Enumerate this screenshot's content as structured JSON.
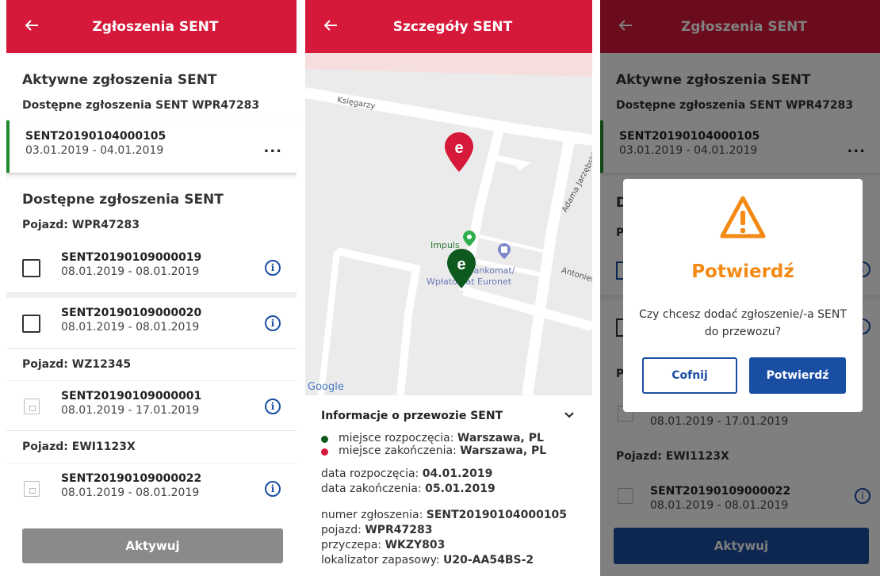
{
  "screen1": {
    "title": "Zgłoszenia SENT",
    "active_header": "Aktywne zgłoszenia SENT",
    "active_sub": "Dostępne zgłoszenia SENT WPR47283",
    "active_item": {
      "code": "SENT20190104000105",
      "dates": "03.01.2019 - 04.01.2019",
      "more": "..."
    },
    "available_header": "Dostępne zgłoszenia SENT",
    "groups": [
      {
        "vehicle": "Pojazd: WPR47283",
        "items": [
          {
            "code": "SENT20190109000019",
            "dates": "08.01.2019 - 08.01.2019"
          },
          {
            "code": "SENT20190109000020",
            "dates": "08.01.2019 - 08.01.2019"
          }
        ]
      },
      {
        "vehicle": "Pojazd: WZ12345",
        "items": [
          {
            "code": "SENT20190109000001",
            "dates": "08.01.2019 - 17.01.2019"
          }
        ]
      },
      {
        "vehicle": "Pojazd: EWI1123X",
        "items": [
          {
            "code": "SENT20190109000022",
            "dates": "08.01.2019 - 08.01.2019"
          }
        ]
      }
    ],
    "activate_label": "Aktywuj"
  },
  "screen2": {
    "title": "Szczegóły SENT",
    "map_labels": {
      "street1": "Księgarzy",
      "street2": "Adama Jarzębskiego",
      "street3": "Antoniewska",
      "poi1": "Impuls",
      "poi2": "Bankomat/",
      "poi3": "Wpłatomat Euronet",
      "google": "Google"
    },
    "info_title": "Informacje o przewozie SENT",
    "start_label": "miejsce rozpoczęcia: ",
    "start_value": "Warszawa, PL",
    "end_label": "miejsce zakończenia: ",
    "end_value": "Warszawa, PL",
    "date_start_label": "data rozpoczęcia: ",
    "date_start_value": "04.01.2019",
    "date_end_label": "data zakończenia: ",
    "date_end_value": "05.01.2019",
    "number_label": "numer zgłoszenia: ",
    "number_value": "SENT20190104000105",
    "vehicle_label": "pojazd: ",
    "vehicle_value": "WPR47283",
    "trailer_label": "przyczepa: ",
    "trailer_value": "WKZY803",
    "locator_label": "lokalizator zapasowy: ",
    "locator_value": "U20-AA54BS-2"
  },
  "screen3": {
    "title": "Zgłoszenia SENT",
    "active_header": "Aktywne zgłoszenia SENT",
    "active_sub": "Dostępne zgłoszenia SENT WPR47283",
    "active_item": {
      "code": "SENT20190104000105",
      "dates": "03.01.2019 - 04.01.2019"
    },
    "bg_dates": "08.01.2019 - 17.01.2019",
    "bg_vehicle": "Pojazd: EWI1123X",
    "bg_item": {
      "code": "SENT20190109000022",
      "dates": "08.01.2019 - 08.01.2019"
    },
    "dialog_title": "Potwierdź",
    "dialog_message": "Czy chcesz dodać zgłoszenie/-a SENT do przewozu?",
    "cancel_label": "Cofnij",
    "confirm_label": "Potwierdź",
    "activate_label": "Aktywuj"
  },
  "colors": {
    "brand_red": "#d6183a",
    "active_green": "#1f8a2d",
    "link_blue": "#1a4ea3",
    "warning_orange": "#f28a14",
    "pin_green": "#0e5a1e"
  }
}
